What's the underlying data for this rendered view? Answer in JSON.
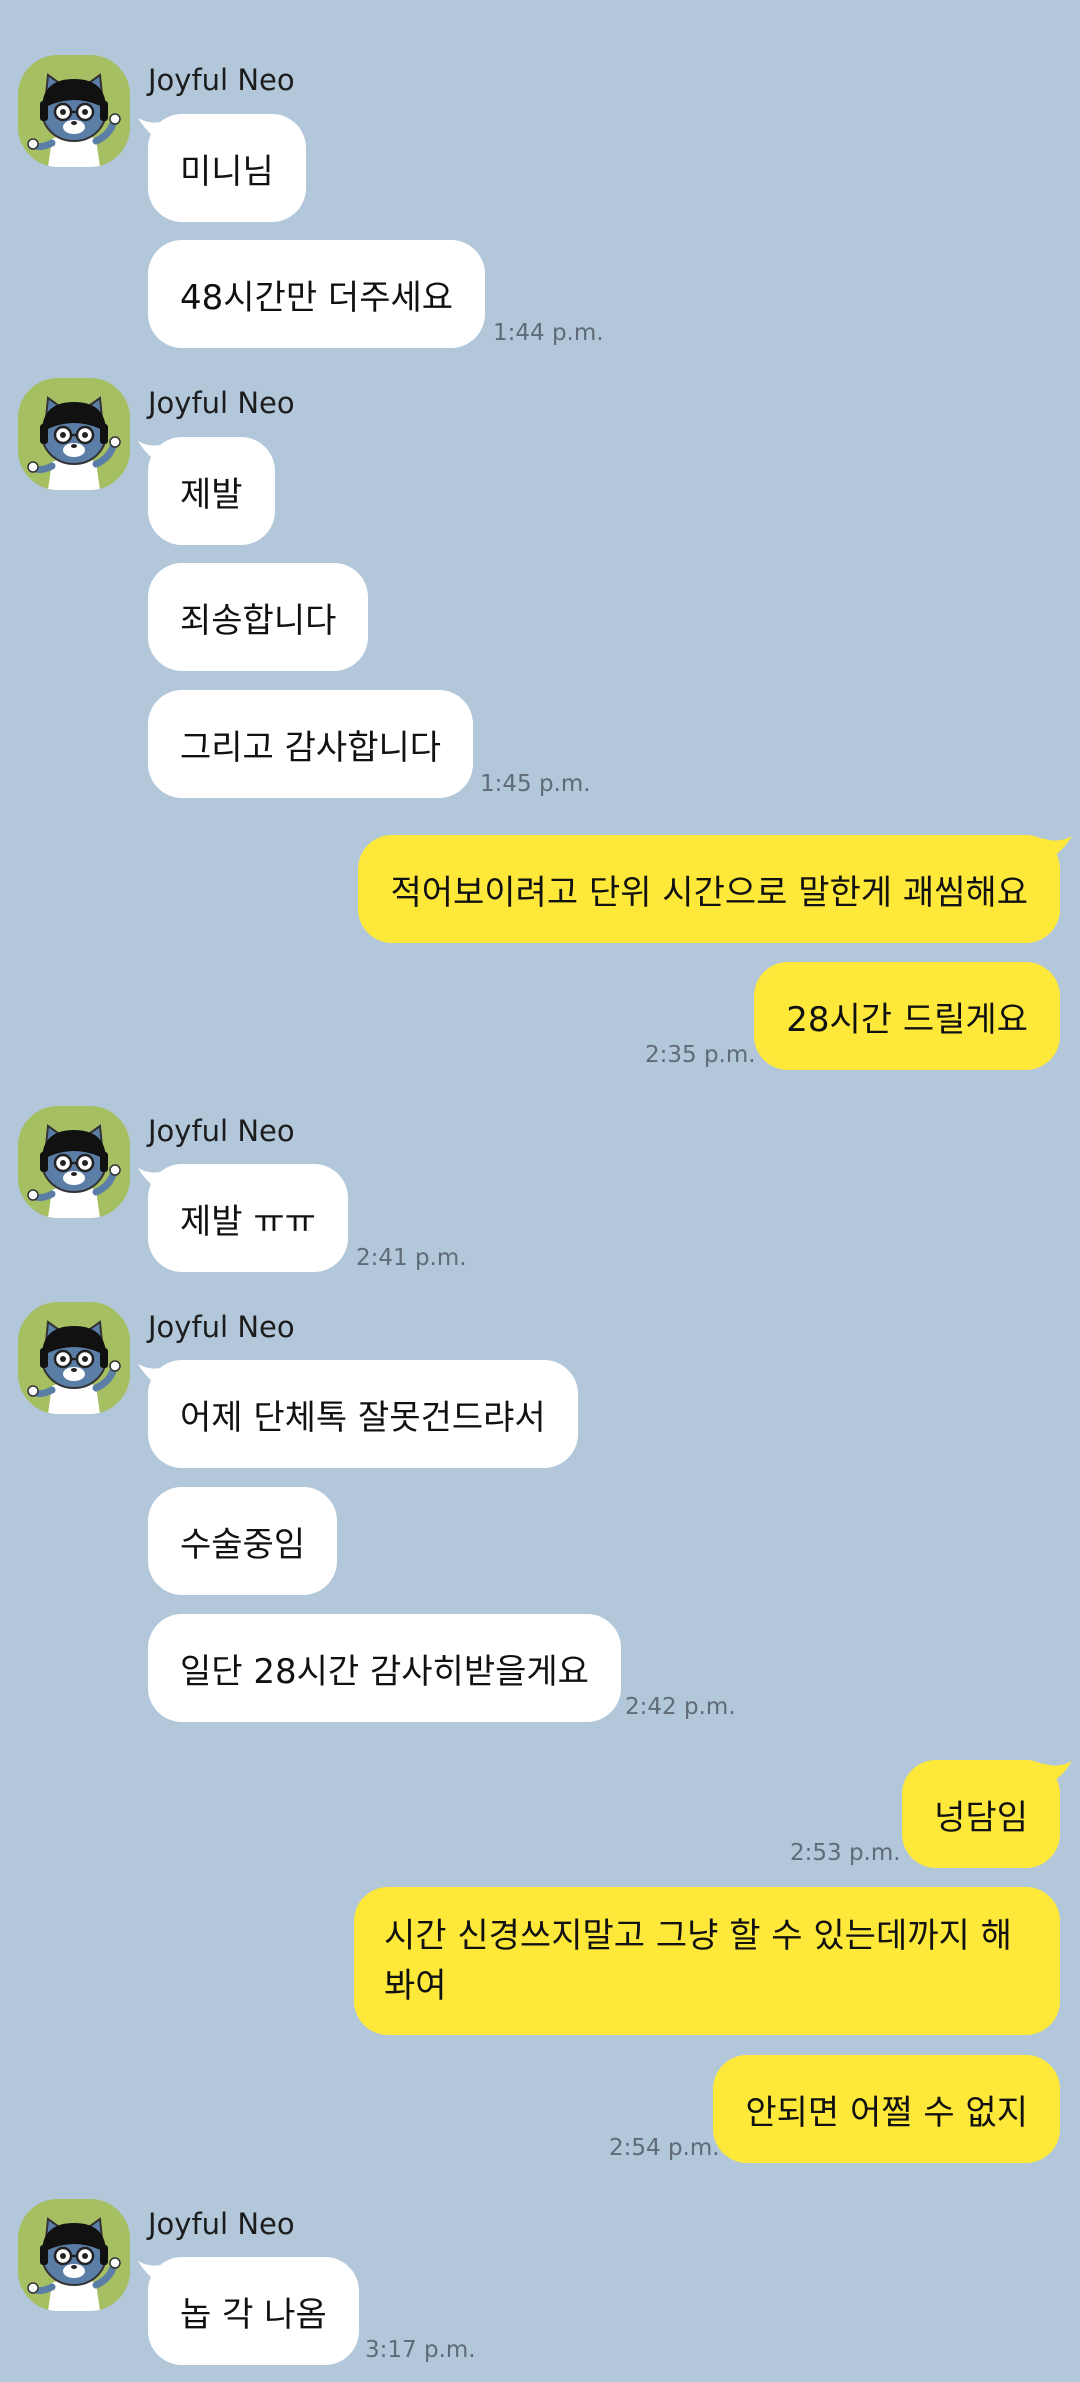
{
  "colors": {
    "background": "#b2c7da",
    "incoming_bubble": "#ffffff",
    "outgoing_bubble": "#fee83a",
    "avatar_bg": "#a6bf63"
  },
  "sender_name": "Joyful Neo",
  "messages": {
    "m1": "미니님",
    "m2": "48시간만 더주세요",
    "t1": "1:44 p.m.",
    "m3": "제발",
    "m4": "죄송합니다",
    "m5": "그리고 감사합니다",
    "t2": "1:45 p.m.",
    "o1": "적어보이려고 단위 시간으로 말한게 괘씸해요",
    "o2": "28시간 드릴게요",
    "t3": "2:35 p.m.",
    "m6": "제발 ㅠㅠ",
    "t4": "2:41 p.m.",
    "m7": "어제 단체톡 잘못건드랴서",
    "m8": "수술중임",
    "m9": "일단 28시간 감사히받을게요",
    "t5": "2:42 p.m.",
    "o3": "넝담임",
    "t6": "2:53 p.m.",
    "o4": "시간 신경쓰지말고 그냥 할 수 있는데까지 해봐여",
    "o5": "안되면 어쩔 수 없지",
    "t7": "2:54 p.m.",
    "m10": "놉 각 나옴",
    "t8": "3:17 p.m."
  }
}
